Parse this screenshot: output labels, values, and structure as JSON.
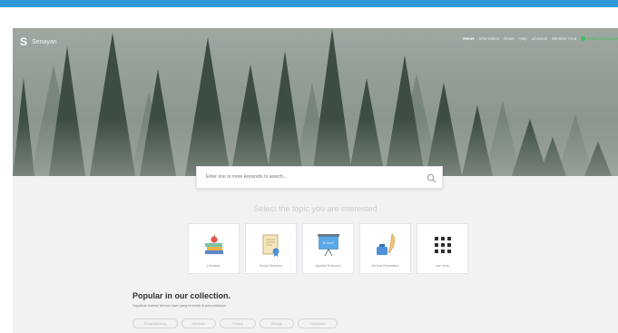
{
  "brand": {
    "logo": "S",
    "name": "Senayan"
  },
  "nav": [
    {
      "label": "Home",
      "active": true
    },
    {
      "label": "Information",
      "active": false
    },
    {
      "label": "News",
      "active": false
    },
    {
      "label": "Help",
      "active": false
    },
    {
      "label": "Librarian",
      "active": false
    },
    {
      "label": "Member Area",
      "active": false
    }
  ],
  "language": {
    "label": "Select Language"
  },
  "search": {
    "placeholder": "Enter one or more keywords to search...",
    "icon": "magnifier"
  },
  "topics_title": "Select the topic you are interested",
  "topics": [
    {
      "label": "Literature",
      "icon": "books-apple"
    },
    {
      "label": "Social Sciences",
      "icon": "certificate-scroll"
    },
    {
      "label": "Applied Sciences",
      "icon": "presentation-board"
    },
    {
      "label": "Art and Recreation",
      "icon": "ink-quill"
    },
    {
      "label": "see more",
      "icon": "grid-dots"
    }
  ],
  "popular": {
    "title": "Popular in our collection.",
    "subtitle": "Dapatkan koleksi terbaru kami yang tersedia di perpustakaan."
  },
  "tags": [
    "Programming",
    "Website",
    "Poetry",
    "Biologi",
    "Komputer"
  ],
  "colors": {
    "topbar": "#2e9bd6",
    "page_bg": "#f1f2f4",
    "language_green": "#3fbf5e"
  }
}
